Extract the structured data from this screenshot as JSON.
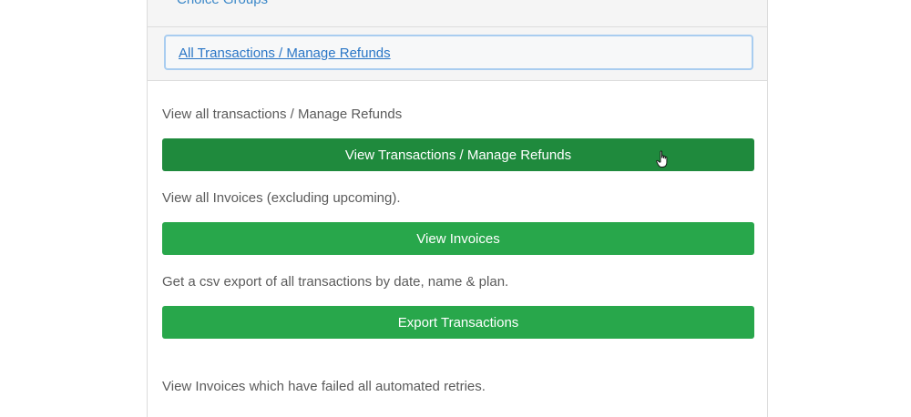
{
  "nav": {
    "top_link": "Choice Groups"
  },
  "header": {
    "active_link": "All Transactions / Manage Refunds"
  },
  "sections": [
    {
      "description": "View all transactions / Manage Refunds",
      "button_label": "View Transactions / Manage Refunds"
    },
    {
      "description": "View all Invoices (excluding upcoming).",
      "button_label": "View Invoices"
    },
    {
      "description": "Get a csv export of all transactions by date, name & plan.",
      "button_label": "Export Transactions"
    },
    {
      "description": "View Invoices which have failed all automated retries."
    }
  ],
  "colors": {
    "button_green": "#28a74b",
    "button_green_hover": "#1f8a3d",
    "link_blue": "#2a76c6"
  },
  "cursor": {
    "icon": "hand-pointer-icon"
  }
}
